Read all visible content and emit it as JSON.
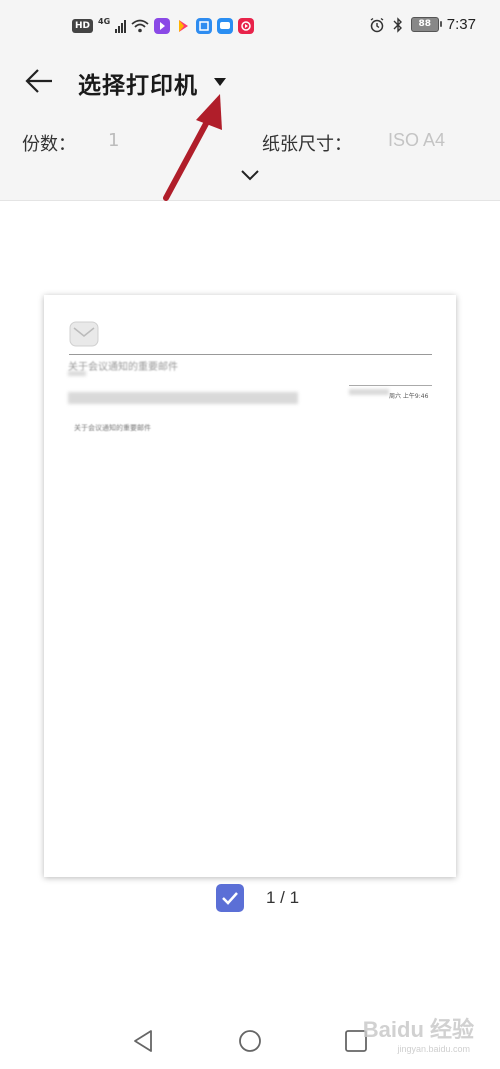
{
  "status_bar": {
    "hd_label": "HD",
    "network_label": "4G",
    "battery_level": "88",
    "time": "7:37"
  },
  "header": {
    "title": "选择打印机",
    "copies_label": "份数：",
    "copies_value": "1",
    "paper_size_label": "纸张尺寸：",
    "paper_size_value": "ISO A4"
  },
  "preview": {
    "email_subject": "关于会议通知的重要邮件",
    "email_time": "周六 上午9:46",
    "email_body": "关于会议通知的重要邮件",
    "page_selected": true,
    "page_indicator": "1 / 1"
  },
  "watermark": {
    "logo": "Baidu 经验",
    "sub": "jingyan.baidu.com"
  },
  "colors": {
    "accent": "#5b6fd6",
    "annotation": "#b01e2a",
    "header_bg": "#f5f5f5"
  },
  "icons": [
    "back-arrow-icon",
    "dropdown-caret-icon",
    "chevron-down-icon",
    "mail-icon",
    "checkbox-checked-icon",
    "nav-back-icon",
    "nav-home-icon",
    "nav-recent-icon"
  ]
}
